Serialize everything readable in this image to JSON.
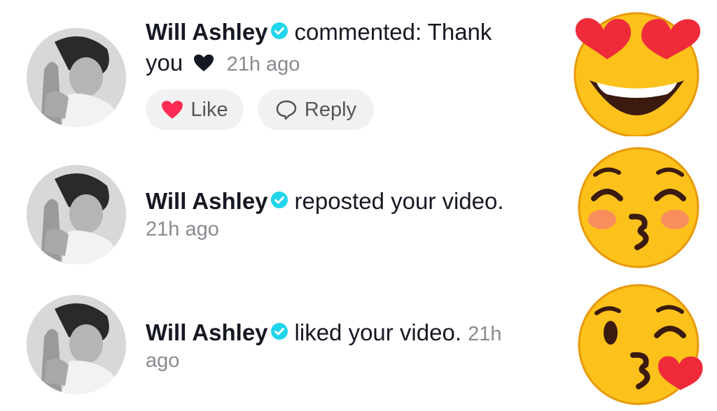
{
  "notifications": [
    {
      "user": "Will Ashley",
      "action": "commented: Thank",
      "action_line2": "you",
      "time": "21h ago",
      "like_label": "Like",
      "reply_label": "Reply",
      "emoji": "heart-eyes-emoji"
    },
    {
      "user": "Will Ashley",
      "action": "reposted your video.",
      "time": "21h ago",
      "emoji": "kissing-blush-emoji"
    },
    {
      "user": "Will Ashley",
      "action": "liked your video.",
      "time_part1": "21h",
      "time_part2": "ago",
      "emoji": "kiss-wink-heart-emoji"
    }
  ],
  "colors": {
    "verified": "#20d5ec",
    "like_heart": "#fe2c55",
    "timestamp": "#8a8b91"
  }
}
